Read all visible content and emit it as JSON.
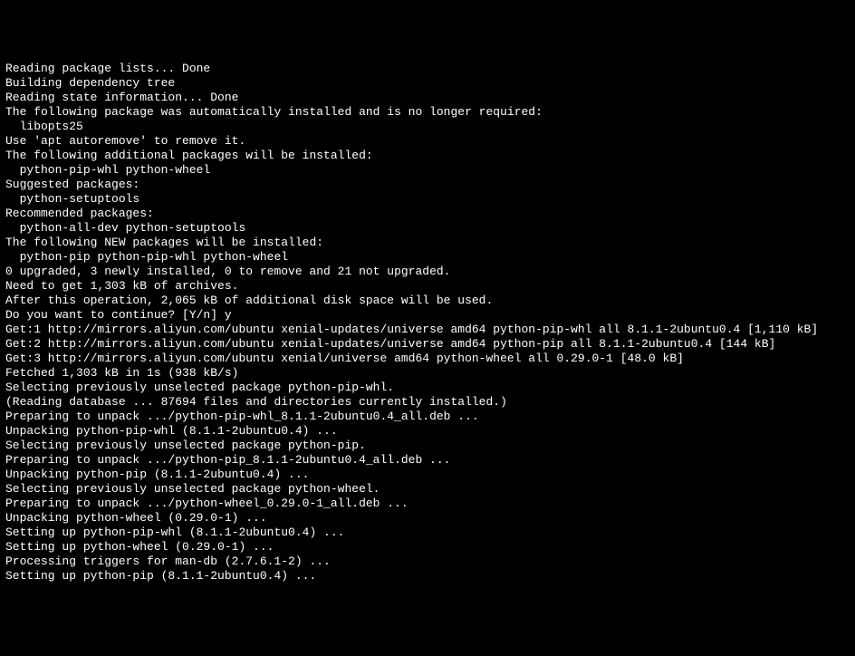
{
  "terminal": {
    "lines": [
      "Reading package lists... Done",
      "Building dependency tree",
      "Reading state information... Done",
      "The following package was automatically installed and is no longer required:",
      "  libopts25",
      "Use 'apt autoremove' to remove it.",
      "The following additional packages will be installed:",
      "  python-pip-whl python-wheel",
      "Suggested packages:",
      "  python-setuptools",
      "Recommended packages:",
      "  python-all-dev python-setuptools",
      "The following NEW packages will be installed:",
      "  python-pip python-pip-whl python-wheel",
      "0 upgraded, 3 newly installed, 0 to remove and 21 not upgraded.",
      "Need to get 1,303 kB of archives.",
      "After this operation, 2,065 kB of additional disk space will be used.",
      "Do you want to continue? [Y/n] y",
      "Get:1 http://mirrors.aliyun.com/ubuntu xenial-updates/universe amd64 python-pip-whl all 8.1.1-2ubuntu0.4 [1,110 kB]",
      "Get:2 http://mirrors.aliyun.com/ubuntu xenial-updates/universe amd64 python-pip all 8.1.1-2ubuntu0.4 [144 kB]",
      "Get:3 http://mirrors.aliyun.com/ubuntu xenial/universe amd64 python-wheel all 0.29.0-1 [48.0 kB]",
      "Fetched 1,303 kB in 1s (938 kB/s)",
      "Selecting previously unselected package python-pip-whl.",
      "(Reading database ... 87694 files and directories currently installed.)",
      "Preparing to unpack .../python-pip-whl_8.1.1-2ubuntu0.4_all.deb ...",
      "Unpacking python-pip-whl (8.1.1-2ubuntu0.4) ...",
      "Selecting previously unselected package python-pip.",
      "Preparing to unpack .../python-pip_8.1.1-2ubuntu0.4_all.deb ...",
      "Unpacking python-pip (8.1.1-2ubuntu0.4) ...",
      "Selecting previously unselected package python-wheel.",
      "Preparing to unpack .../python-wheel_0.29.0-1_all.deb ...",
      "Unpacking python-wheel (0.29.0-1) ...",
      "Setting up python-pip-whl (8.1.1-2ubuntu0.4) ...",
      "Setting up python-wheel (0.29.0-1) ...",
      "Processing triggers for man-db (2.7.6.1-2) ...",
      "Setting up python-pip (8.1.1-2ubuntu0.4) ..."
    ]
  }
}
